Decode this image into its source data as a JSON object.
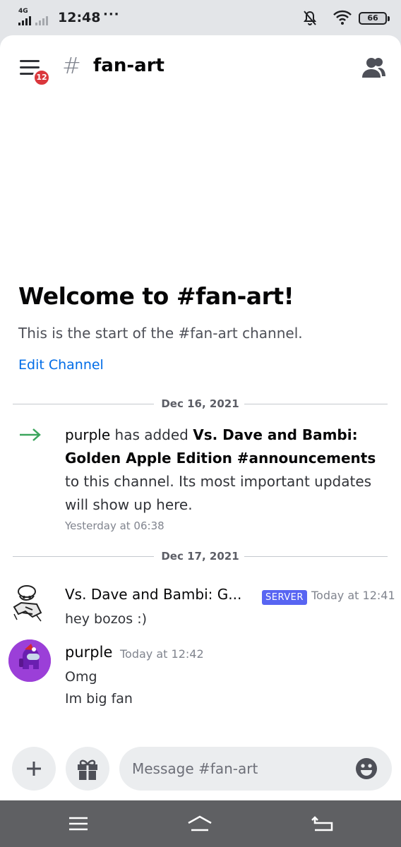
{
  "status_bar": {
    "network": "4G",
    "time": "12:48",
    "dots": "···",
    "battery": "66"
  },
  "header": {
    "hash": "#",
    "channel_name": "fan-art",
    "notification_count": "12"
  },
  "welcome": {
    "title": "Welcome to #fan-art!",
    "subtitle": "This is the start of the #fan-art channel.",
    "edit_channel": "Edit Channel"
  },
  "dividers": [
    "Dec 16, 2021",
    "Dec 17, 2021"
  ],
  "system_message": {
    "user": "purple",
    "text_1": " has added ",
    "server": "Vs. Dave and Bambi: Golden Apple Edition #announcements",
    "text_2": " to this channel. Its most important updates will show up here.",
    "time": "Yesterday at 06:38"
  },
  "messages": [
    {
      "author": "Vs. Dave and Bambi: G...",
      "tag": "SERVER",
      "time": "Today at 12:41",
      "lines": [
        "hey bozos :)"
      ]
    },
    {
      "author": "purple",
      "time": "Today at 12:42",
      "lines": [
        "Omg",
        "Im big fan"
      ]
    }
  ],
  "composer": {
    "placeholder": "Message #fan-art"
  },
  "colors": {
    "accent_link": "#006ce7",
    "server_tag": "#5865f2",
    "badge": "#da373c",
    "system_arrow": "#3ba55c"
  },
  "icons": [
    "menu-icon",
    "members-icon",
    "join-arrow-icon",
    "plus-icon",
    "gift-icon",
    "emoji-icon",
    "nav-menu-icon",
    "nav-home-icon",
    "nav-back-icon"
  ]
}
